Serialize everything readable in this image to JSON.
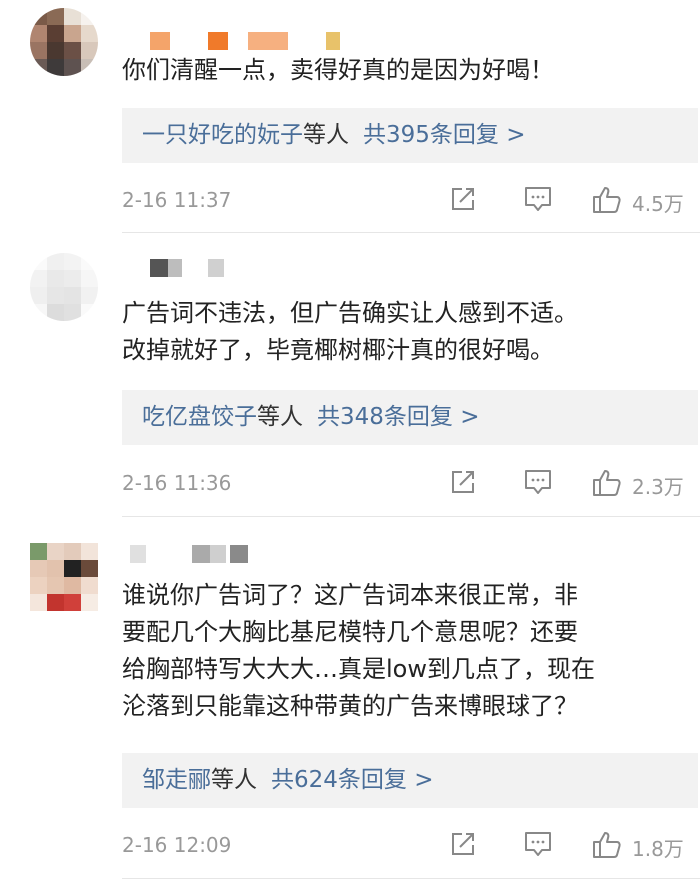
{
  "comments": [
    {
      "text_lines": [
        "你们清醒一点，卖得好真的是因为好喝！"
      ],
      "reply_user": "一只好吃的妧子",
      "reply_etc": "等人",
      "reply_count": "共395条回复 >",
      "time": "2-16 11:37",
      "likes": "4.5万"
    },
    {
      "text_lines": [
        "广告词不违法，但广告确实让人感到不适。",
        "改掉就好了，毕竟椰树椰汁真的很好喝。"
      ],
      "reply_user": "吃亿盘饺子",
      "reply_etc": "等人",
      "reply_count": "共348条回复 >",
      "time": "2-16 11:36",
      "likes": "2.3万"
    },
    {
      "text_lines": [
        "谁说你广告词了？这广告词本来很正常，非",
        "要配几个大胸比基尼模特几个意思呢？还要",
        "给胸部特写大大大…真是low到几点了，现在",
        "沦落到只能靠这种带黄的广告来博眼球了？"
      ],
      "reply_user": "邹走郦",
      "reply_etc": "等人",
      "reply_count": "共624条回复 >",
      "time": "2-16 12:09",
      "likes": "1.8万"
    }
  ],
  "icons": {
    "share": "share-icon",
    "reply": "comment-icon",
    "like": "thumbs-up-icon"
  },
  "colors": {
    "link": "#4a6e99",
    "meta": "#999999",
    "reply_bg": "#f2f2f2"
  }
}
